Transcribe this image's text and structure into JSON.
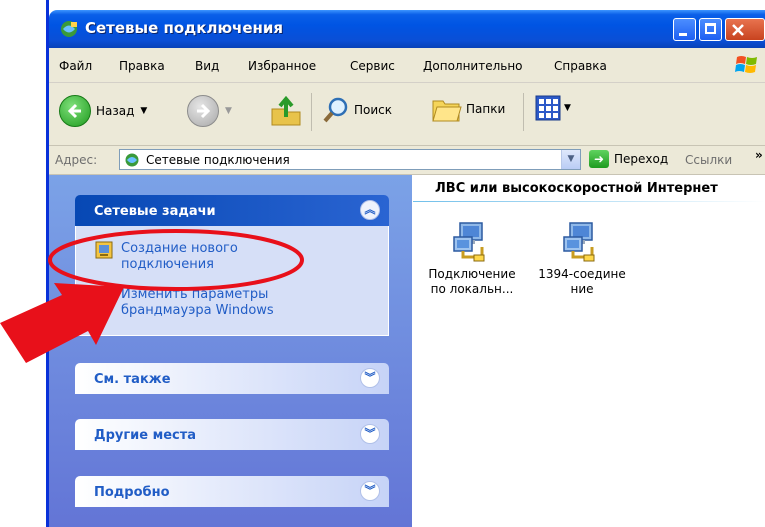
{
  "window": {
    "title": "Сетевые подключения"
  },
  "menu": [
    "Файл",
    "Правка",
    "Вид",
    "Избранное",
    "Сервис",
    "Дополнительно",
    "Справка"
  ],
  "toolbar": {
    "back_label": "Назад",
    "search_label": "Поиск",
    "folders_label": "Папки"
  },
  "address": {
    "label": "Адрес:",
    "value": "Сетевые подключения",
    "go_label": "Переход",
    "links_label": "Ссылки",
    "more": "»"
  },
  "tasks": {
    "network_tasks": {
      "title": "Сетевые задачи",
      "items": [
        "Создание нового\nподключения",
        "Изменить параметры\nбрандмауэра Windows"
      ]
    },
    "see_also": {
      "title": "См. также"
    },
    "other_places": {
      "title": "Другие места"
    },
    "details": {
      "title": "Подробно"
    }
  },
  "content": {
    "group_title": "ЛВС или высокоскоростной Интернет",
    "items": [
      {
        "label": "Подключение\nпо локальн..."
      },
      {
        "label": "1394-соедине\nние"
      }
    ]
  },
  "colors": {
    "title_bar": "#0054e3",
    "task_pane": "#6b8ee0",
    "task_link": "#215dc6",
    "highlight": "#e8101a"
  },
  "icons": [
    "network-connections-icon",
    "back-icon",
    "forward-icon",
    "up-folder-icon",
    "search-icon",
    "folders-icon",
    "views-icon",
    "go-icon",
    "network-connection-icon",
    "create-connection-icon",
    "firewall-icon",
    "collapse-icon",
    "expand-icon"
  ]
}
